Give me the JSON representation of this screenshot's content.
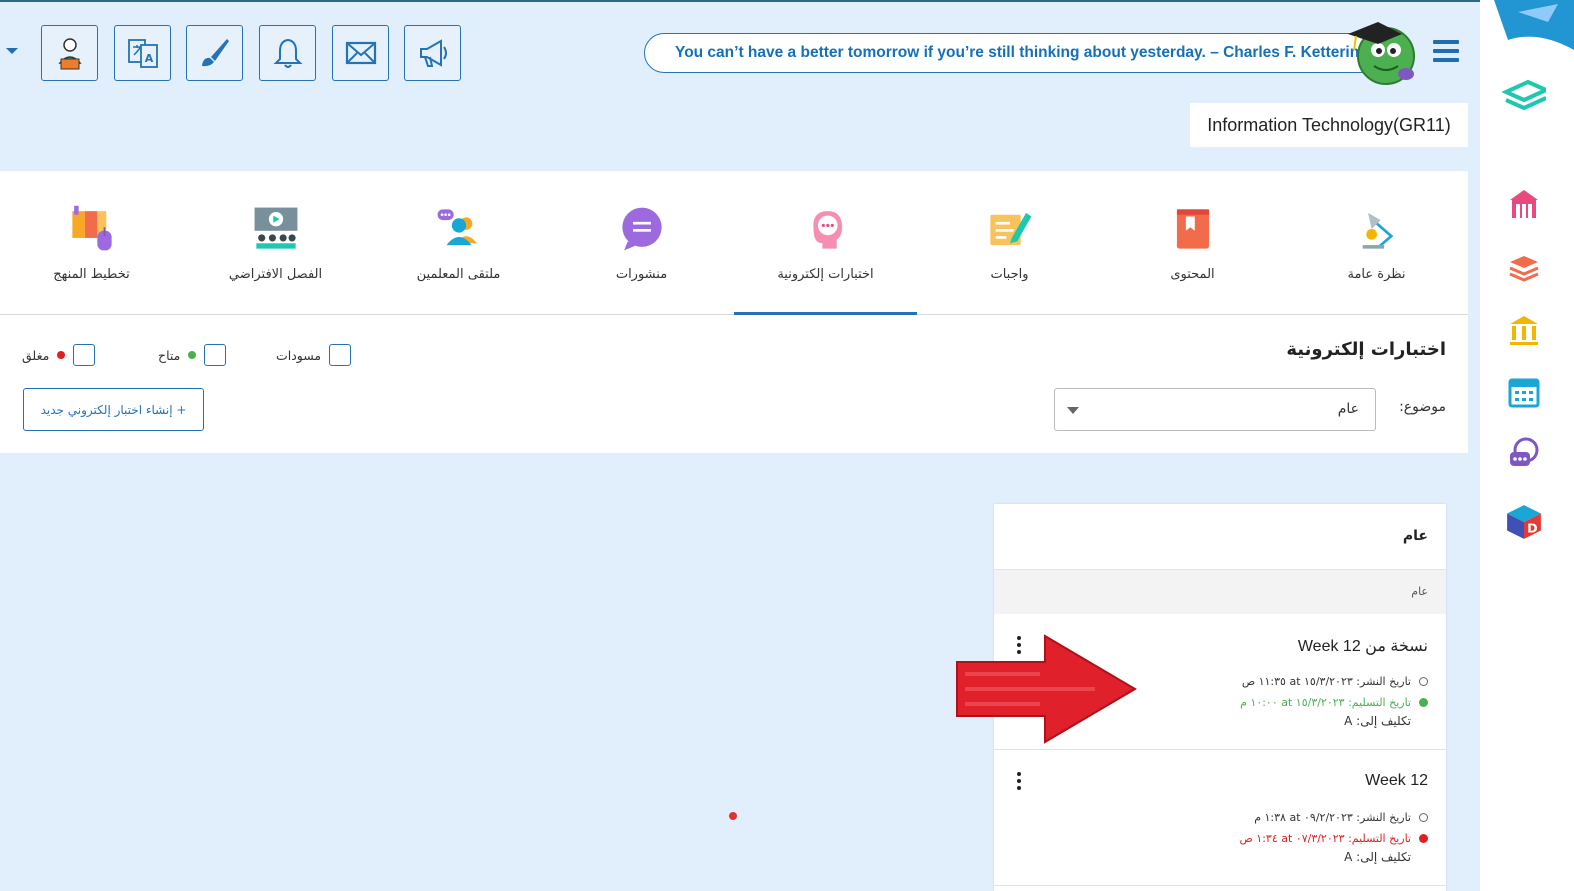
{
  "header": {
    "quote": "You can’t have a better tomorrow if you’re still thinking about yesterday. – Charles F. Kettering",
    "course_title": "Information Technology(GR11)",
    "toolbar_icons": [
      "teacher-icon",
      "translate-icon",
      "brush-icon",
      "bell-icon",
      "mail-icon",
      "megaphone-icon"
    ]
  },
  "nav": {
    "items": [
      {
        "label": "نظرة عامة"
      },
      {
        "label": "المحتوى"
      },
      {
        "label": "واجبات"
      },
      {
        "label": "اختبارات إلكترونية"
      },
      {
        "label": "منشورات"
      },
      {
        "label": "ملتقى المعلمين"
      },
      {
        "label": "الفصل الافتراضي"
      },
      {
        "label": "تخطيط المنهج"
      }
    ],
    "active_index": 3
  },
  "filters": {
    "title": "اختبارات إلكترونية",
    "legend": [
      {
        "label": "مسودات",
        "color": ""
      },
      {
        "label": "متاح",
        "color": "#4caf50"
      },
      {
        "label": "مغلق",
        "color": "#e02020"
      }
    ],
    "subject_label": "موضوع:",
    "subject_value": "عام",
    "create_button": "+ إنشاء اختبار إلكتروني جديد"
  },
  "card": {
    "header": "عام",
    "subheader": "عام",
    "exams": [
      {
        "title": "نسخة من Week 12",
        "publish": "تاريخ النشر: ١٥/٣/٢٠٢٣ at ١١:٣٥ ص",
        "due": "تاريخ التسليم: ١٥/٣/٢٠٢٣ at ١٠:٠٠ م",
        "due_color": "#4caf50",
        "assign": "تكليف إلى: A"
      },
      {
        "title": "Week 12",
        "publish": "تاريخ النشر: ٠٩/٢/٢٠٢٣ at ١:٣٨ م",
        "due": "تاريخ التسليم: ٠٧/٣/٢٠٢٣ at ١:٣٤ ص",
        "due_color": "#e02020",
        "assign": "تكليف إلى: A"
      }
    ]
  },
  "colors": {
    "accent": "#2573b5",
    "background": "#e1eefb",
    "annotation_arrow": "#e0202a"
  }
}
